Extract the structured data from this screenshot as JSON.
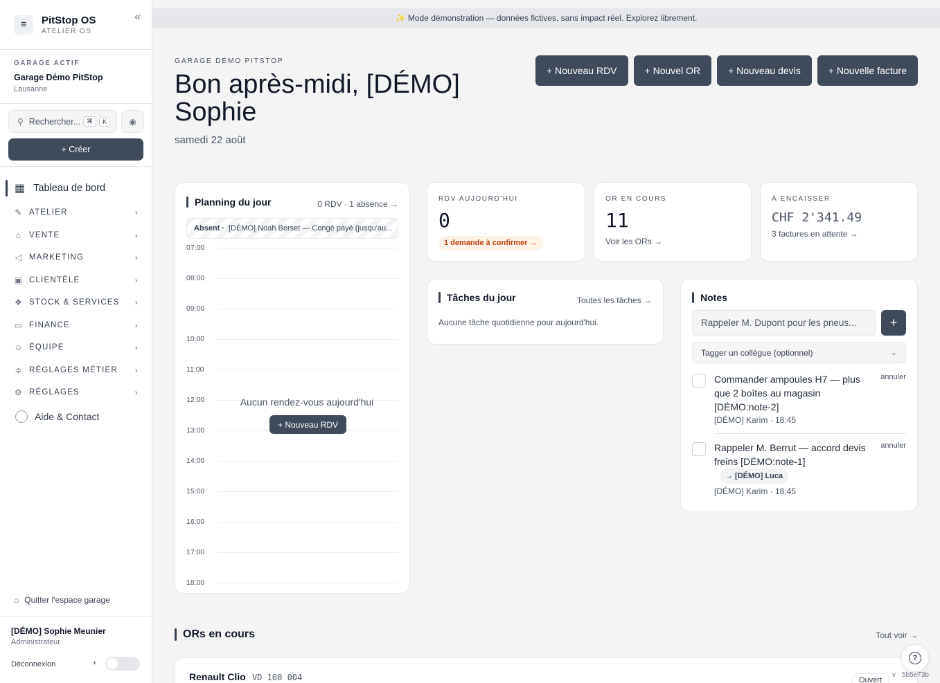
{
  "app": {
    "name": "PitStop OS",
    "subtitle": "ATELIER OS"
  },
  "garage": {
    "label": "GARAGE ACTIF",
    "name": "Garage Démo PitStop",
    "city": "Lausanne"
  },
  "search": {
    "placeholder": "Rechercher...",
    "kbd1": "⌘",
    "kbd2": "K"
  },
  "create_label": "+ Créer",
  "nav": {
    "active": "Tableau de bord",
    "items": [
      {
        "label": "ATELIER",
        "icon": "wrench-icon"
      },
      {
        "label": "VENTE",
        "icon": "store-icon"
      },
      {
        "label": "MARKETING",
        "icon": "megaphone-icon"
      },
      {
        "label": "CLIENTÈLE",
        "icon": "contact-icon"
      },
      {
        "label": "STOCK & SERVICES",
        "icon": "boxes-icon"
      },
      {
        "label": "FINANCE",
        "icon": "wallet-icon"
      },
      {
        "label": "ÉQUIPE",
        "icon": "users-icon"
      },
      {
        "label": "RÉGLAGES MÉTIER",
        "icon": "sliders-icon"
      },
      {
        "label": "RÉGLAGES",
        "icon": "gear-icon"
      }
    ],
    "help": "Aide & Contact"
  },
  "sidebar_footer": {
    "quit": "Quitter l'espace garage",
    "user_name": "[DÉMO] Sophie Meunier",
    "user_role": "Administrateur",
    "logout": "Déconnexion"
  },
  "banner": "✨ Mode démonstration — données fictives, sans impact réel. Explorez librement.",
  "header": {
    "eyebrow": "GARAGE DÉMO PITSTOP",
    "greeting": "Bon après-midi, [DÉMO] Sophie",
    "date": "samedi 22 août"
  },
  "actions": [
    "+ Nouveau RDV",
    "+ Nouvel OR",
    "+ Nouveau devis",
    "+ Nouvelle facture"
  ],
  "planning": {
    "title": "Planning du jour",
    "meta": "0 RDV · 1 absence →",
    "absent_label": "Absent ·",
    "absent_text": "[DÉMO] Noah Berset — Congé payé (jusqu'au...",
    "hours": [
      "07:00",
      "08:00",
      "09:00",
      "10:00",
      "11:00",
      "12:00",
      "13:00",
      "14:00",
      "15:00",
      "16:00",
      "17:00",
      "18:00"
    ],
    "empty": "Aucun rendez-vous aujourd'hui",
    "button": "+ Nouveau RDV"
  },
  "stats": {
    "rdv": {
      "label": "RDV AUJOURD'HUI",
      "value": "0",
      "pill": "1 demande à confirmer →"
    },
    "or": {
      "label": "OR EN COURS",
      "value": "11",
      "link": "Voir les ORs →"
    },
    "cash": {
      "label": "À ENCAISSER",
      "value": "CHF 2'341.49",
      "link": "3 factures en attente →"
    }
  },
  "tasks": {
    "title": "Tâches du jour",
    "meta": "Toutes les tâches →",
    "empty": "Aucune tâche quotidienne pour aujourd'hui."
  },
  "notes": {
    "title": "Notes",
    "input_placeholder": "Rappeler M. Dupont pour les pneus...",
    "add": "+",
    "select": "Tagger un collègue (optionnel)",
    "items": [
      {
        "text": "Commander ampoules H7 — plus que 2 boîtes au magasin [DÉMO:note-2]",
        "by": "[DÉMO] Karim · 18:45",
        "cancel": "annuler"
      },
      {
        "text": "Rappeler M. Berrut — accord devis freins [DÉMO:note-1]",
        "tag": "→ [DÉMO] Luca",
        "by": "[DÉMO] Karim · 18:45",
        "cancel": "annuler"
      }
    ]
  },
  "ors": {
    "title": "ORs en cours",
    "all": "Tout voir →",
    "card": {
      "name": "Renault Clio",
      "plate": "VD 100 004",
      "status": "Ouvert"
    }
  },
  "version": "v · 5b5e73b",
  "colors": {
    "primary": "#3f4a5a",
    "accent_orange": "#c2410c"
  }
}
